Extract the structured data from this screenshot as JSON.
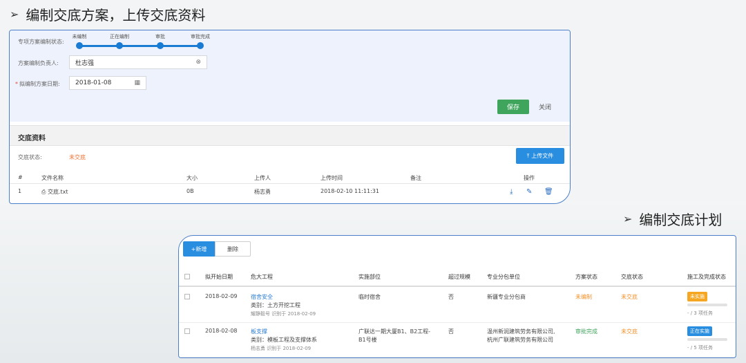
{
  "headings": {
    "h1": "编制交底方案，上传交底资料",
    "h2": "编制交底计划"
  },
  "colors": {
    "primary_blue": "#2a8ee0",
    "save_green": "#3fa55c",
    "status_orange": "#f07030"
  },
  "form": {
    "status_label": "专项方案编制状态:",
    "steps": [
      {
        "label": "未编制"
      },
      {
        "label": "正在编制"
      },
      {
        "label": "审批"
      },
      {
        "label": "审批完成"
      }
    ],
    "owner_label": "方案编制负责人:",
    "owner_value": "杜志强",
    "date_label": "拟编制方案日期:",
    "date_value": "2018-01-08",
    "save": "保存",
    "close": "关闭"
  },
  "materials": {
    "title": "交底资料",
    "status_label": "交底状态:",
    "status_value": "未交底",
    "upload": "上传文件",
    "columns": [
      "#",
      "文件名称",
      "大小",
      "上传人",
      "上传时间",
      "备注",
      "操作"
    ],
    "rows": [
      {
        "no": "1",
        "name": "交底.txt",
        "size": "0B",
        "uploader": "杨志勇",
        "time": "2018-02-10 11:11:31",
        "note": ""
      }
    ]
  },
  "plan": {
    "add": "+新增",
    "delete": "删除",
    "columns": [
      "拟开始日期",
      "危大工程",
      "实施部位",
      "超过规模",
      "专业分包单位",
      "方案状态",
      "交底状态",
      "施工及完成状态"
    ],
    "rows": [
      {
        "date": "2018-02-09",
        "project": "宿舍安全",
        "category": "类别：土方开挖工程",
        "meta": "耀静毅号 识别于 2018-02-09",
        "location1": "临时宿舍",
        "location2": "",
        "oversize": "否",
        "sub1": "新疆专业分包商",
        "sub2": "",
        "plan_status": "未编制",
        "brief_status": "未交底",
        "build_status": "未实施",
        "progress_text": "- / 3 项任务",
        "progress": 0
      },
      {
        "date": "2018-02-08",
        "project": "板支撑",
        "category": "类别：模板工程及支撑体系",
        "meta": "杨志勇 识别于 2018-02-09",
        "location1": "广联达一期大厦B1、B2工程-",
        "location2": "B1号楼",
        "oversize": "否",
        "sub1": "温州新润建筑劳务有限公司,",
        "sub2": "杭州广联建筑劳务有限公司",
        "plan_status": "审批完成",
        "brief_status": "未交底",
        "build_status": "正在实施",
        "progress_text": "- / 5 项任务",
        "progress": 0
      }
    ]
  }
}
